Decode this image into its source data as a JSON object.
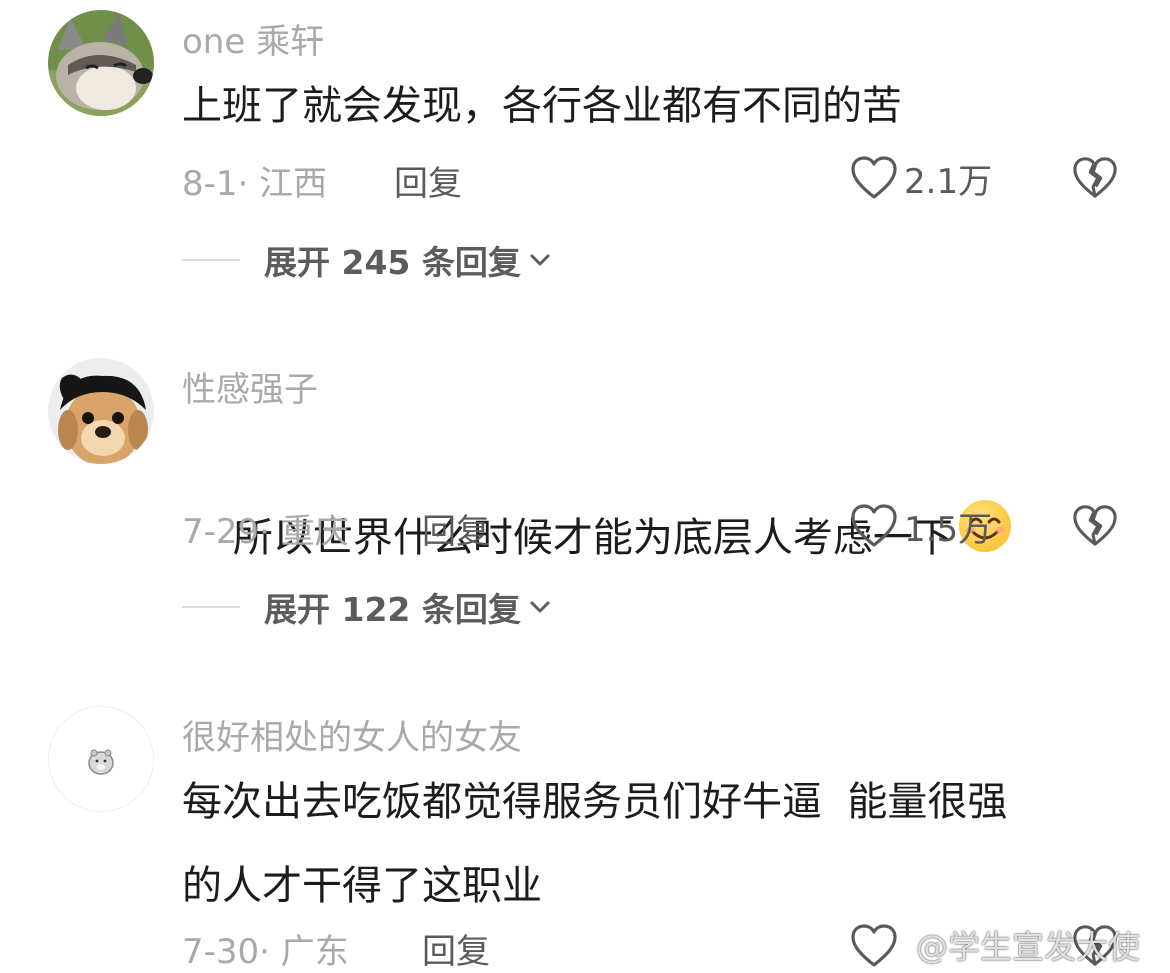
{
  "comments": [
    {
      "username": "one 乘轩",
      "text": "上班了就会发现，各行各业都有不同的苦",
      "meta": "8-1· 江西",
      "reply_label": "回复",
      "likes": "2.1万",
      "expand_label": "展开 245 条回复",
      "avatar_icon": "husky-dog-avatar"
    },
    {
      "username": "性感强子",
      "text": "所以世界什么时候才能为底层人考虑一下",
      "emoji": "smiling-face-emoji",
      "meta": "7-29· 重庆",
      "reply_label": "回复",
      "likes": "1.5万",
      "expand_label": "展开 122 条回复",
      "avatar_icon": "puppy-with-hair-avatar"
    },
    {
      "username": "很好相处的女人的女友",
      "text": "每次出去吃饭都觉得服务员们好牛逼  能量很强\n的人才干得了这职业",
      "meta": "7-30· 广东",
      "reply_label": "回复",
      "likes": "",
      "avatar_icon": "hamster-avatar"
    }
  ],
  "watermark": "@学生宣发大使",
  "colors": {
    "text": "#1c1c1c",
    "muted": "#a9a9a9",
    "secondary": "#5a5a5a",
    "divider": "#dcdcdc"
  }
}
